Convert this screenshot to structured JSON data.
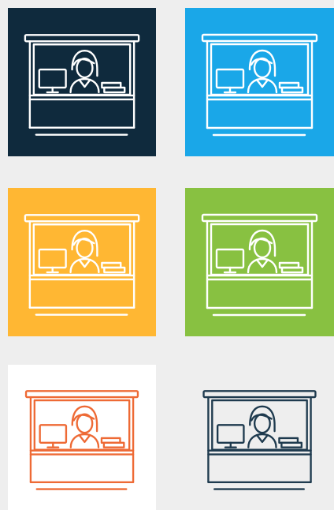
{
  "icon_name": "reception-booth-icon",
  "tiles": [
    {
      "name": "tile-dark-navy",
      "background": "#0f2a3d",
      "stroke": "#ffffff"
    },
    {
      "name": "tile-sky-blue",
      "background": "#1aa7e8",
      "stroke": "#ffffff"
    },
    {
      "name": "tile-orange",
      "background": "#ffb733",
      "stroke": "#ffffff"
    },
    {
      "name": "tile-green",
      "background": "#88c141",
      "stroke": "#ffffff"
    },
    {
      "name": "tile-white",
      "background": "#ffffff",
      "stroke": "#ee6a35"
    },
    {
      "name": "tile-gray",
      "background": "#eeeeee",
      "stroke": "#1e3a4e"
    }
  ]
}
